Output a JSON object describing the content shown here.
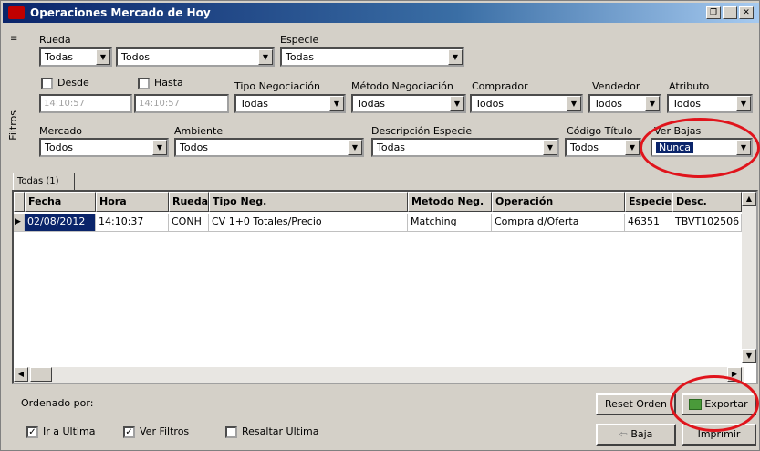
{
  "window": {
    "title": "Operaciones Mercado de Hoy"
  },
  "filters": {
    "side_label": "Filtros",
    "rueda": {
      "label": "Rueda",
      "value": "Todas"
    },
    "col2": {
      "value": "Todos"
    },
    "especie": {
      "label": "Especie",
      "value": "Todas"
    },
    "desde": {
      "label": "Desde",
      "value": "14:10:57"
    },
    "hasta": {
      "label": "Hasta",
      "value": "14:10:57"
    },
    "tipo_negociacion": {
      "label": "Tipo Negociación",
      "value": "Todas"
    },
    "metodo_negociacion": {
      "label": "Método Negociación",
      "value": "Todas"
    },
    "comprador": {
      "label": "Comprador",
      "value": "Todos"
    },
    "vendedor": {
      "label": "Vendedor",
      "value": "Todos"
    },
    "atributo": {
      "label": "Atributo",
      "value": "Todos"
    },
    "mercado": {
      "label": "Mercado",
      "value": "Todos"
    },
    "ambiente": {
      "label": "Ambiente",
      "value": "Todos"
    },
    "descripcion_especie": {
      "label": "Descripción Especie",
      "value": "Todas"
    },
    "codigo_titulo": {
      "label": "Código Título",
      "value": "Todos"
    },
    "ver_bajas": {
      "label": "Ver Bajas",
      "value": "Nunca"
    }
  },
  "tabs": [
    {
      "label": "Todas (1)"
    }
  ],
  "table": {
    "columns": [
      "Fecha",
      "Hora",
      "Rueda",
      "Tipo Neg.",
      "Metodo Neg.",
      "Operación",
      "Especie",
      "Desc."
    ],
    "rows": [
      [
        "02/08/2012",
        "14:10:37",
        "CONH",
        "CV 1+0 Totales/Precio",
        "Matching",
        "Compra d/Oferta",
        "46351",
        "TBVT102506"
      ]
    ]
  },
  "bottom": {
    "ordenado_por": "Ordenado por:",
    "ir_ultima": "Ir a Ultima",
    "ver_filtros": "Ver Filtros",
    "resaltar_ultima": "Resaltar Ultima",
    "reset_orden": "Reset Orden",
    "exportar": "Exportar",
    "baja": "Baja",
    "imprimir": "Imprimir"
  },
  "colors": {
    "title_bar": "#0a246a",
    "selection": "#0a246a",
    "highlight_ring": "#e0141c",
    "window_bg": "#d4d0c8"
  }
}
